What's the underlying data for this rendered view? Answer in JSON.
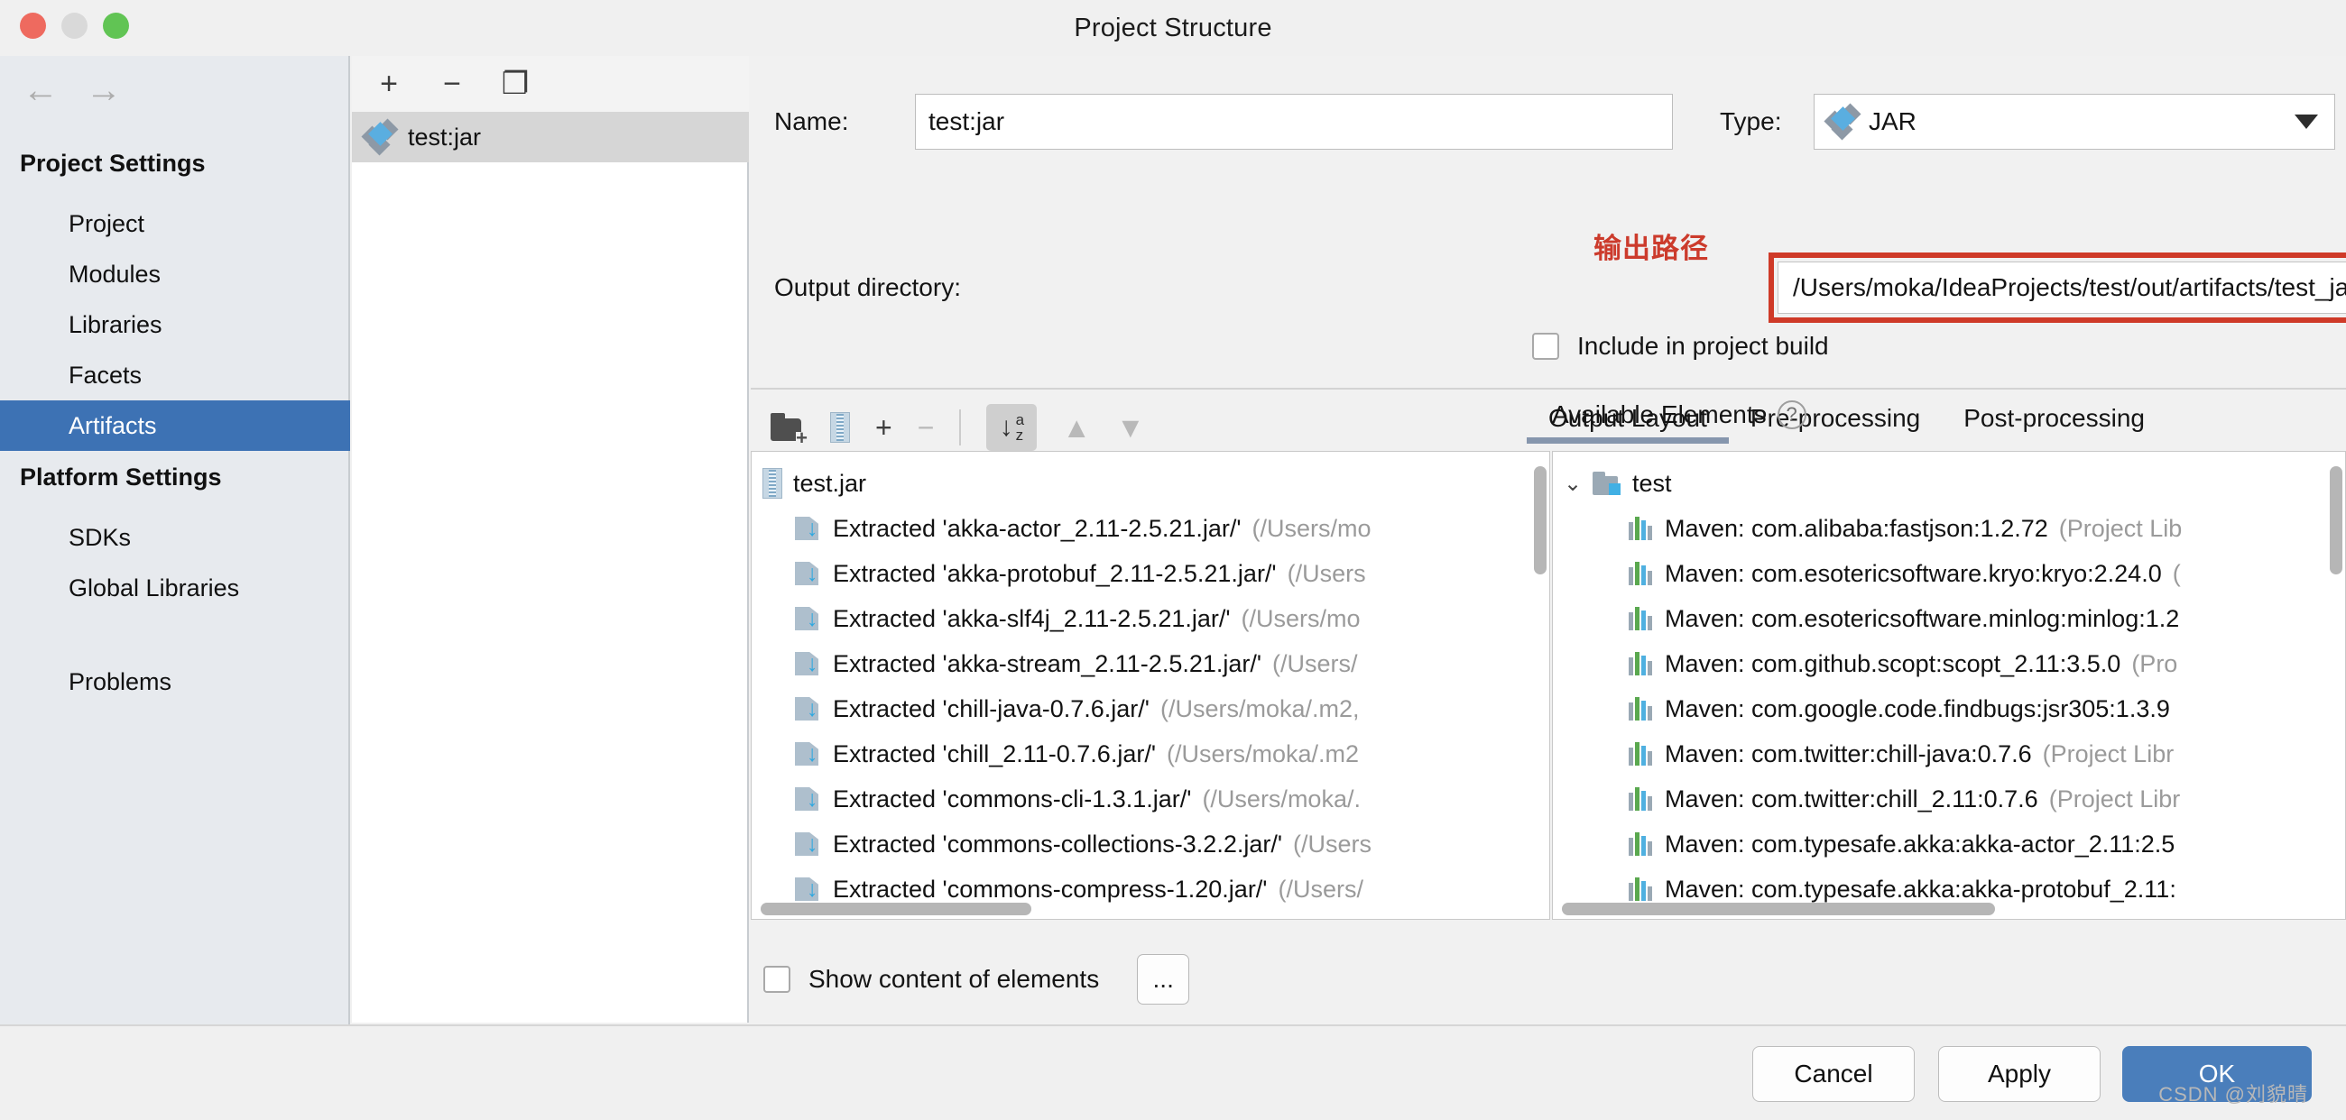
{
  "window": {
    "title": "Project Structure",
    "traffic_lights": [
      "close-red",
      "minimize-yellow",
      "zoom-green"
    ]
  },
  "sidebar": {
    "back_icon": "←",
    "forward_icon": "→",
    "sections": [
      {
        "heading": "Project Settings",
        "items": [
          {
            "label": "Project",
            "selected": false
          },
          {
            "label": "Modules",
            "selected": false
          },
          {
            "label": "Libraries",
            "selected": false
          },
          {
            "label": "Facets",
            "selected": false
          },
          {
            "label": "Artifacts",
            "selected": true
          }
        ]
      },
      {
        "heading": "Platform Settings",
        "items": [
          {
            "label": "SDKs",
            "selected": false
          },
          {
            "label": "Global Libraries",
            "selected": false
          }
        ]
      },
      {
        "heading": "",
        "items": [
          {
            "label": "Problems",
            "selected": false
          }
        ]
      }
    ],
    "help_label": "?"
  },
  "artifacts_panel": {
    "toolbar": [
      {
        "name": "add-artifact-button",
        "glyph": "+"
      },
      {
        "name": "remove-artifact-button",
        "glyph": "−"
      },
      {
        "name": "copy-artifact-button",
        "glyph": "❐"
      }
    ],
    "items": [
      {
        "label": "test:jar",
        "icon": "jar-artifact-icon",
        "selected": true
      }
    ]
  },
  "detail": {
    "name_label": "Name:",
    "name_value": "test:jar",
    "type_label": "Type:",
    "type_value": "JAR",
    "output_dir_label": "Output directory:",
    "output_dir_value": "/Users/moka/IdeaProjects/test/out/artifacts/test_jar",
    "annotation_cn": "输出路径",
    "annotation_color": "#cc3b2c",
    "highlight_box_color": "#cf3a28",
    "include_in_build_label": "Include in project build",
    "include_in_build_checked": false,
    "browse_icon": "🗀"
  },
  "tabs": [
    {
      "label": "Output Layout",
      "active": true
    },
    {
      "label": "Pre-processing",
      "active": false
    },
    {
      "label": "Post-processing",
      "active": false
    }
  ],
  "tree_toolbar": [
    {
      "name": "add-directory-button",
      "glyph": "folder-plus",
      "enabled": true
    },
    {
      "name": "add-archive-button",
      "glyph": "jar",
      "enabled": true
    },
    {
      "name": "add-element-button",
      "glyph": "+",
      "enabled": true
    },
    {
      "name": "remove-element-button",
      "glyph": "−",
      "enabled": false
    },
    {
      "name": "sort-az-button",
      "glyph": "az",
      "enabled": true
    },
    {
      "name": "move-up-button",
      "glyph": "▲",
      "enabled": false
    },
    {
      "name": "move-down-button",
      "glyph": "▼",
      "enabled": false
    }
  ],
  "output_layout_tree": {
    "root": {
      "label": "test.jar",
      "icon": "jar-icon"
    },
    "children": [
      {
        "label": "Extracted 'akka-actor_2.11-2.5.21.jar/'",
        "path": "(/Users/mo"
      },
      {
        "label": "Extracted 'akka-protobuf_2.11-2.5.21.jar/'",
        "path": "(/Users"
      },
      {
        "label": "Extracted 'akka-slf4j_2.11-2.5.21.jar/'",
        "path": "(/Users/mo"
      },
      {
        "label": "Extracted 'akka-stream_2.11-2.5.21.jar/'",
        "path": "(/Users/"
      },
      {
        "label": "Extracted 'chill-java-0.7.6.jar/'",
        "path": "(/Users/moka/.m2,"
      },
      {
        "label": "Extracted 'chill_2.11-0.7.6.jar/'",
        "path": "(/Users/moka/.m2"
      },
      {
        "label": "Extracted 'commons-cli-1.3.1.jar/'",
        "path": "(/Users/moka/."
      },
      {
        "label": "Extracted 'commons-collections-3.2.2.jar/'",
        "path": "(/Users"
      },
      {
        "label": "Extracted 'commons-compress-1.20.jar/'",
        "path": "(/Users/"
      }
    ]
  },
  "available_elements": {
    "title": "Available Elements",
    "help_badge": "?",
    "root": {
      "label": "test",
      "expanded": true,
      "chevron": "⌄"
    },
    "children": [
      {
        "label": "Maven: com.alibaba:fastjson:1.2.72",
        "suffix": "(Project Lib"
      },
      {
        "label": "Maven: com.esotericsoftware.kryo:kryo:2.24.0",
        "suffix": "("
      },
      {
        "label": "Maven: com.esotericsoftware.minlog:minlog:1.2",
        "suffix": ""
      },
      {
        "label": "Maven: com.github.scopt:scopt_2.11:3.5.0",
        "suffix": "(Pro"
      },
      {
        "label": "Maven: com.google.code.findbugs:jsr305:1.3.9",
        "suffix": ""
      },
      {
        "label": "Maven: com.twitter:chill-java:0.7.6",
        "suffix": "(Project Libr"
      },
      {
        "label": "Maven: com.twitter:chill_2.11:0.7.6",
        "suffix": "(Project Libr"
      },
      {
        "label": "Maven: com.typesafe.akka:akka-actor_2.11:2.5",
        "suffix": ""
      },
      {
        "label": "Maven: com.typesafe.akka:akka-protobuf_2.11:",
        "suffix": ""
      }
    ]
  },
  "footer": {
    "show_content_label": "Show content of elements",
    "show_content_checked": false,
    "dots_button_label": "...",
    "buttons": [
      {
        "name": "cancel-button",
        "label": "Cancel",
        "primary": false
      },
      {
        "name": "apply-button",
        "label": "Apply",
        "primary": false
      },
      {
        "name": "ok-button",
        "label": "OK",
        "primary": true
      }
    ],
    "accent_color": "#4a7ebb"
  },
  "watermark": "CSDN @刘貌晴"
}
